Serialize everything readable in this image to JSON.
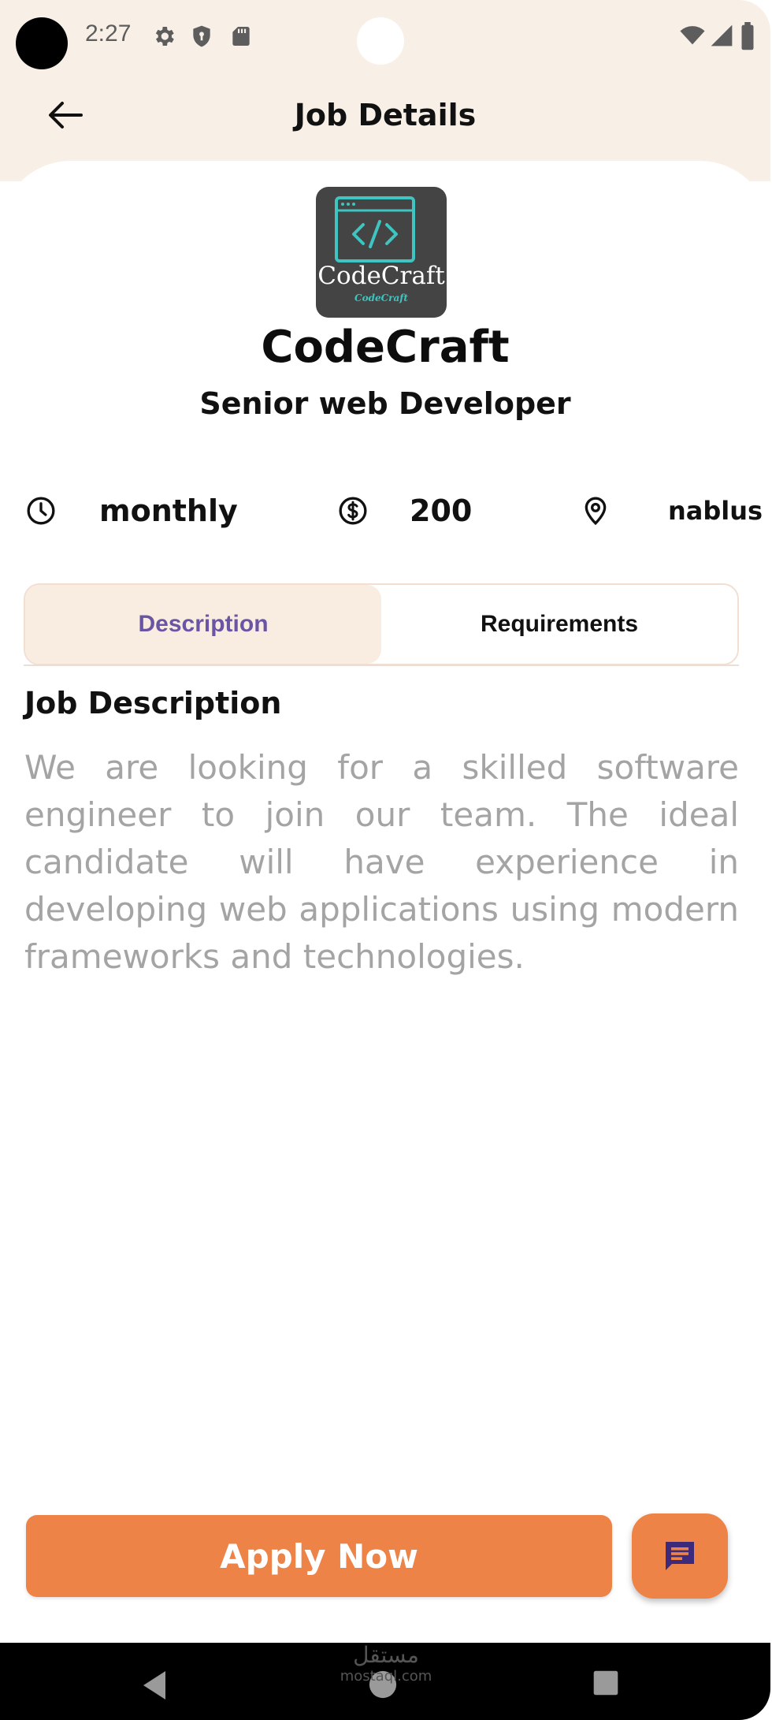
{
  "status_bar": {
    "time": "2:27"
  },
  "header": {
    "title": "Job Details",
    "back_icon": "arrow-left-icon"
  },
  "company": {
    "name": "CodeCraft",
    "logo_text": "CodeCraft",
    "logo_subtext": "CodeCraft",
    "logo_icon": "code-window-icon"
  },
  "job": {
    "title": "Senior web Developer",
    "meta": {
      "period": "monthly",
      "salary": "200",
      "location": "nablus"
    }
  },
  "tabs": [
    {
      "label": "Description",
      "active": true
    },
    {
      "label": "Requirements",
      "active": false
    }
  ],
  "description": {
    "heading": "Job Description",
    "body": "We are looking for a skilled software engineer to join our team. The ideal candidate will have experience in developing web applications using modern frameworks and technologies."
  },
  "actions": {
    "apply_label": "Apply Now",
    "chat_icon": "chat-icon"
  },
  "watermark": {
    "arabic": "مستقل",
    "latin": "mostaql.com"
  },
  "colors": {
    "header_bg": "#f8efe6",
    "accent": "#ed8346",
    "tab_active_text": "#6a55a4",
    "description_text": "#a4a4a4"
  }
}
